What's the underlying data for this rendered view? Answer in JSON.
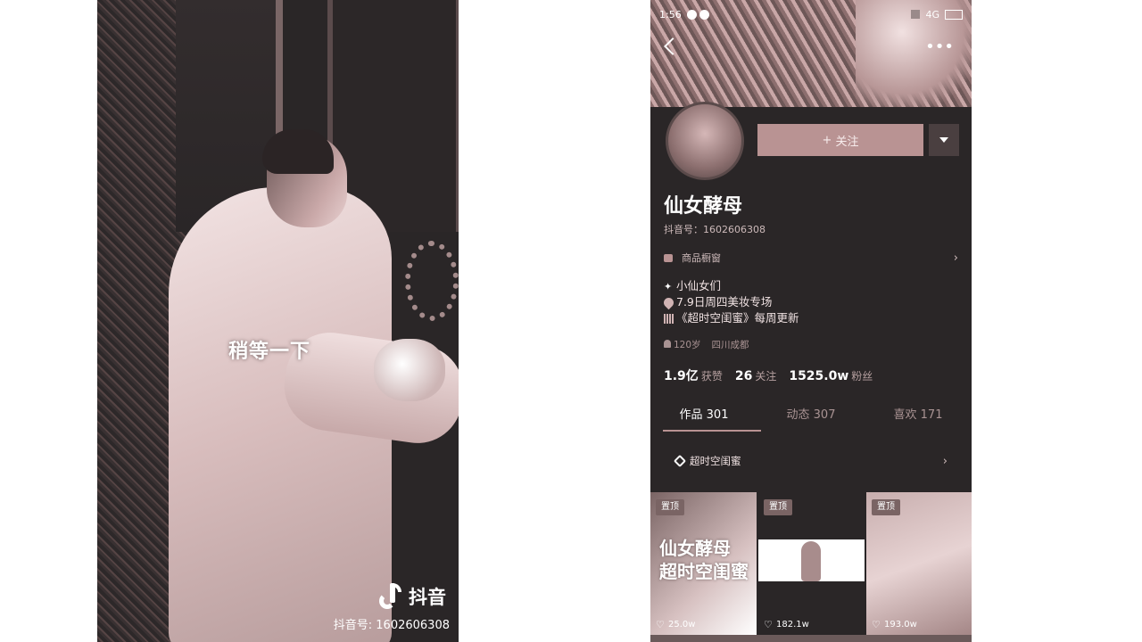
{
  "video": {
    "subtitle": "稍等一下",
    "logo_text": "抖音",
    "douyin_id": "抖音号: 1602606308"
  },
  "profile": {
    "status_time": "1:56",
    "status_network": "4G",
    "follow_label": "关注",
    "name": "仙女酵母",
    "uid": "抖音号：1602606308",
    "shop_label": "商品橱窗",
    "bio": [
      "小仙女们",
      "7.9日周四美妆专场",
      "《超时空闺蜜》每周更新"
    ],
    "meta": {
      "age": "120岁",
      "location": "四川成都"
    },
    "stats": [
      {
        "num": "1.9亿",
        "label": "获赞"
      },
      {
        "num": "26",
        "label": "关注"
      },
      {
        "num": "1525.0w",
        "label": "粉丝"
      }
    ],
    "tabs": [
      {
        "label": "作品 301"
      },
      {
        "label": "动态 307"
      },
      {
        "label": "喜欢 171"
      }
    ],
    "collection_label": "超时空闺蜜",
    "videos": [
      {
        "tag": "置顶",
        "overlay_line1": "仙女酵母",
        "overlay_line2": "超时空闺蜜",
        "likes": "25.0w"
      },
      {
        "tag": "置顶",
        "likes": "182.1w"
      },
      {
        "tag": "置顶",
        "likes": "193.0w"
      }
    ]
  },
  "colors": {
    "accent": "#b99393",
    "background": "#2a2627"
  }
}
